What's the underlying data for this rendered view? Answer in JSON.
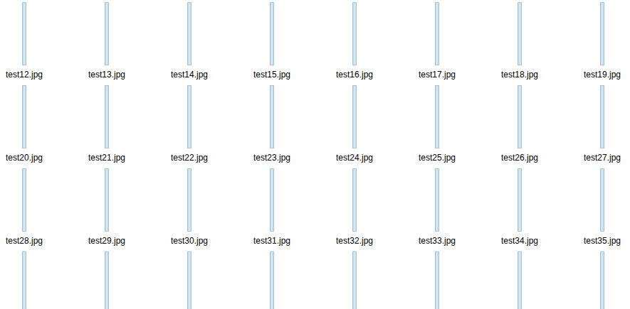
{
  "files": [
    {
      "kind": "labeled",
      "name": "test12.jpg"
    },
    {
      "kind": "labeled",
      "name": "test13.jpg"
    },
    {
      "kind": "labeled",
      "name": "test14.jpg"
    },
    {
      "kind": "labeled",
      "name": "test15.jpg"
    },
    {
      "kind": "labeled",
      "name": "test16.jpg"
    },
    {
      "kind": "labeled",
      "name": "test17.jpg"
    },
    {
      "kind": "labeled",
      "name": "test18.jpg"
    },
    {
      "kind": "labeled",
      "name": "test19.jpg"
    },
    {
      "kind": "labeled",
      "name": "test20.jpg"
    },
    {
      "kind": "labeled",
      "name": "test21.jpg"
    },
    {
      "kind": "labeled",
      "name": "test22.jpg"
    },
    {
      "kind": "labeled",
      "name": "test23.jpg"
    },
    {
      "kind": "labeled",
      "name": "test24.jpg"
    },
    {
      "kind": "labeled",
      "name": "test25.jpg"
    },
    {
      "kind": "labeled",
      "name": "test26.jpg"
    },
    {
      "kind": "labeled",
      "name": "test27.jpg"
    },
    {
      "kind": "labeled",
      "name": "test28.jpg"
    },
    {
      "kind": "labeled",
      "name": "test29.jpg"
    },
    {
      "kind": "labeled",
      "name": "test30.jpg"
    },
    {
      "kind": "labeled",
      "name": "test31.jpg"
    },
    {
      "kind": "labeled",
      "name": "test32.jpg"
    },
    {
      "kind": "labeled",
      "name": "test33.jpg"
    },
    {
      "kind": "labeled",
      "name": "test34.jpg"
    },
    {
      "kind": "labeled",
      "name": "test35.jpg"
    },
    {
      "kind": "cut-off"
    },
    {
      "kind": "cut-off"
    },
    {
      "kind": "cut-off"
    },
    {
      "kind": "cut-off"
    },
    {
      "kind": "cut-off"
    },
    {
      "kind": "cut-off"
    },
    {
      "kind": "cut-off"
    },
    {
      "kind": "cut-off"
    }
  ]
}
